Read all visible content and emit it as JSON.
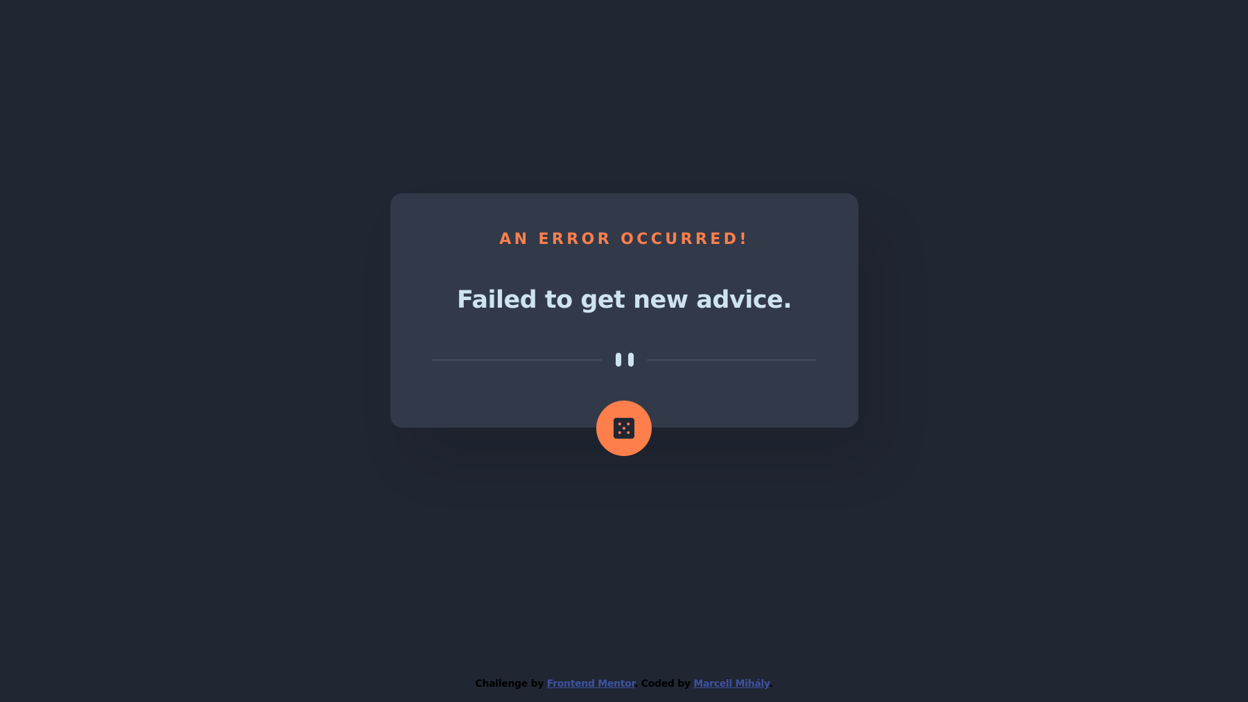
{
  "colors": {
    "background": "#202632",
    "card": "#323a49",
    "accent": "#ff7f4c",
    "text": "#cfe3ed",
    "divider": "#4f5d74",
    "link": "#3e52a3"
  },
  "card": {
    "advice_id": "AN ERROR OCCURRED!",
    "advice_text": "Failed to get new advice.",
    "divider_icon": "pause-icon"
  },
  "dice_button": {
    "icon": "dice-icon"
  },
  "attribution": {
    "challenge_prefix": "Challenge by ",
    "challenge_link": "Frontend Mentor",
    "separator": ". Coded by ",
    "author_link": "Marcell Mihály",
    "suffix": "."
  }
}
